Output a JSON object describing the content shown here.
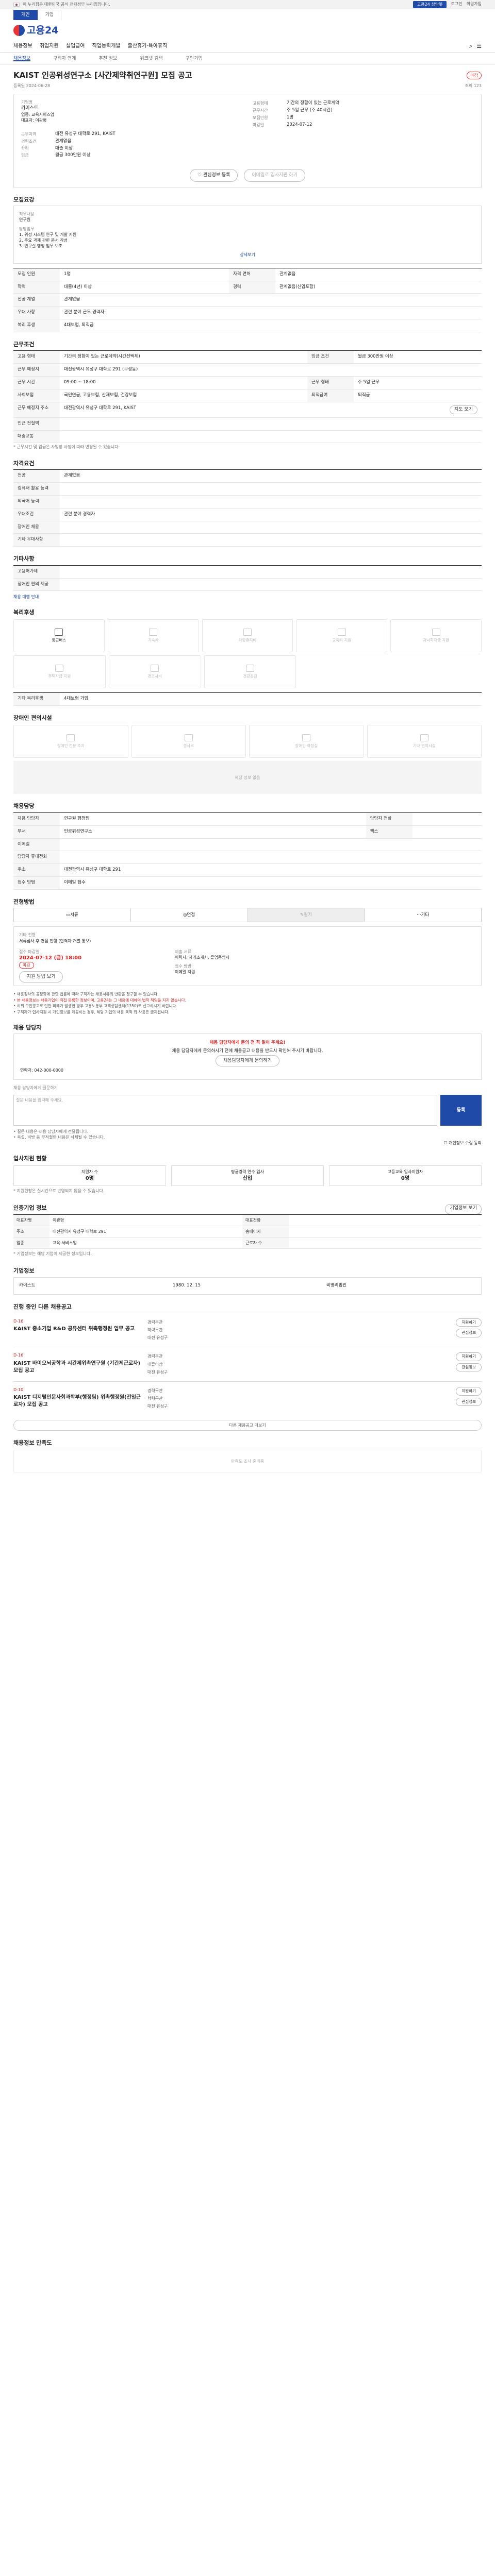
{
  "govbar": {
    "text": "이 누리집은 대한민국 공식 전자정부 누리집입니다.",
    "chat": "고용24 상담봇",
    "links": [
      "로그인",
      "회원가입"
    ]
  },
  "site_tabs": [
    "개인",
    "기업"
  ],
  "logo": "고용24",
  "nav": [
    "채용정보",
    "취업지원",
    "실업급여",
    "직업능력개발",
    "출산휴가·육아휴직"
  ],
  "breadcrumb": [
    "채용정보",
    "구직자 연계",
    "추천 정보",
    "워크넷 검색",
    "구인기업"
  ],
  "job": {
    "title": "KAIST 인공위성연구소 [사간제약취연구원] 모집 공고",
    "badge": "마감",
    "posted": "등록일 2024-06-28",
    "views": "조회 123",
    "company": "카이스트",
    "company_label": "기업명",
    "company_detail": [
      "업종: 교육서비스업",
      "대표자: 이광형"
    ],
    "left_kv": [
      [
        "근무지역",
        "대전 유성구 대학로 291, KAIST"
      ],
      [
        "경력조건",
        "관계없음"
      ],
      [
        "학력",
        "대졸 이상"
      ],
      [
        "임금",
        "월급 300만원 이상"
      ]
    ],
    "right_kv": [
      [
        "고용형태",
        "기간의 정함이 있는 근로계약"
      ],
      [
        "근무시간",
        "주 5일 근무 (주 40시간)"
      ],
      [
        "모집인원",
        "1명"
      ],
      [
        "마감일",
        "2024-07-12"
      ]
    ],
    "btn_save": "관심정보 등록",
    "btn_apply": "이메일로 입사지원 하기"
  },
  "recruit": {
    "title": "모집요강",
    "job_name_label": "직무내용",
    "job_name": "연구원",
    "duties_label": "담당업무",
    "duties": [
      "1. 위성 시스템 연구 및 개발 지원",
      "2. 주요 과제 관련 문서 작성",
      "3. 연구실 행정 업무 보조"
    ],
    "toggle": "상세보기",
    "rows": [
      [
        "모집 인원",
        "1명",
        "자격 면허",
        "관계없음"
      ],
      [
        "학력",
        "대졸(4년) 이상",
        "경력",
        "관계없음(신입포함)"
      ],
      [
        "전공 계열",
        "관계없음",
        "",
        ""
      ],
      [
        "우대 사항",
        "관련 분야 근무 경력자",
        "",
        ""
      ],
      [
        "복리 후생",
        "4대보험, 퇴직금",
        "",
        ""
      ]
    ]
  },
  "work": {
    "title": "근무조건",
    "rows": [
      [
        "고용 형태",
        "기간의 정함이 있는 근로계약(시간선택제)",
        "임금 조건",
        "월급 300만원 이상"
      ],
      [
        "근무 예정지",
        "대전광역시 유성구 대학로 291 (구성동)",
        "",
        ""
      ],
      [
        "근무 시간",
        "09:00 ~ 18:00",
        "근무 형태",
        "주 5일 근무"
      ],
      [
        "사회보험",
        "국민연금, 고용보험, 산재보험, 건강보험",
        "퇴직급여",
        "퇴직금"
      ],
      [
        "근무 예정지 주소",
        "대전광역시 유성구 대학로 291, KAIST",
        "",
        ""
      ],
      [
        "인근 전철역",
        "",
        "",
        ""
      ],
      [
        "대중교통",
        "",
        "",
        ""
      ]
    ],
    "map_btn": "지도 보기",
    "note": "* 근무시간 및 임금은 사업장 사정에 따라 변경될 수 있습니다."
  },
  "qual": {
    "title": "자격요건",
    "rows": [
      [
        "전공",
        "관계없음"
      ],
      [
        "컴퓨터 활용 능력",
        ""
      ],
      [
        "외국어 능력",
        ""
      ],
      [
        "우대조건",
        "관련 분야 경력자"
      ],
      [
        "장애인 채용",
        ""
      ],
      [
        "기타 우대사항",
        ""
      ]
    ]
  },
  "etc": {
    "title": "기타사항",
    "rows": [
      [
        "고용허가제",
        ""
      ],
      [
        "장애인 편의 제공",
        ""
      ]
    ],
    "link": "채용 대행 안내"
  },
  "welfare": {
    "title": "복리후생",
    "items": [
      "통근버스",
      "기숙사",
      "차량유지비",
      "교육비 지원",
      "자녀학자금 지원",
      "주택자금 지원",
      "경조사비",
      "건강검진"
    ],
    "other_label": "기타 복리후생",
    "other": "4대보험 가입"
  },
  "disability": {
    "title": "장애인 편의시설",
    "items": [
      "장애인 전용 주차",
      "경사로",
      "장애인 화장실",
      "기타 편의시설"
    ],
    "empty": "해당 정보 없음"
  },
  "contact": {
    "title": "채용담당",
    "rows": [
      [
        "채용 담당자",
        "연구원 행정팀",
        "담당자 전화",
        ""
      ],
      [
        "부서",
        "인공위성연구소",
        "팩스",
        ""
      ],
      [
        "이메일",
        "",
        "",
        ""
      ],
      [
        "담당자 휴대전화",
        "",
        "",
        ""
      ],
      [
        "주소",
        "대전광역시 유성구 대학로 291",
        "",
        ""
      ],
      [
        "접수 방법",
        "이메일 접수",
        "",
        ""
      ]
    ]
  },
  "apply": {
    "title": "전형방법",
    "steps": [
      "서류",
      "면접",
      "필기",
      "기타"
    ],
    "active": 2,
    "method_label": "기타 전형",
    "method": "서류심사 후 면접 진행 (합격자 개별 통보)",
    "deadline_label": "접수 마감일",
    "deadline": "2024-07-12 (금) 18:00",
    "badge": "마감",
    "docs_label": "제출 서류",
    "docs": "이력서, 자기소개서, 졸업증명서",
    "apply_label": "접수 방법",
    "apply_way": "이메일 지원",
    "method_btn": "지원 방법 보기"
  },
  "legal": [
    "• 채용절차의 공정화에 관한 법률에 따라 구직자는 채용서류의 반환을 청구할 수 있습니다.",
    "• 본 채용정보는 채용기업이 직접 등록한 정보이며, 고용24는 그 내용에 대하여 법적 책임을 지지 않습니다.",
    "• 허위 구인광고로 인한 피해가 발생한 경우 고용노동부 고객상담센터(1350)로 신고하시기 바랍니다.",
    "• 구직자가 입사지원 시 개인정보를 제공하는 경우, 해당 기업의 채용 목적 외 사용은 금지됩니다."
  ],
  "warn": {
    "title": "채용 담당자",
    "head": "채용 담당자에게 문의 전 꼭 읽어 주세요!",
    "body": "채용 담당자에게 문의하시기 전에 채용공고 내용을 반드시 확인해 주시기 바랍니다.",
    "btn": "채용담당자에게 문의하기",
    "contact_line": "연락처: 042-000-0000",
    "qa_label": "채용 담당자에게 질문하기",
    "qa_placeholder": "질문 내용을 입력해 주세요.",
    "qa_submit": "등록",
    "notes": [
      "• 질문 내용은 채용 담당자에게 전달됩니다.",
      "• 욕설, 비방 등 부적절한 내용은 삭제될 수 있습니다."
    ],
    "privacy": "개인정보 수집 동의"
  },
  "stats": {
    "title": "입사지원 현황",
    "items": [
      [
        "지원자 수",
        "0명"
      ],
      [
        "평균경력 연수 입사",
        "신입"
      ],
      [
        "고등교육 입사지원자",
        "0명"
      ]
    ],
    "note": "* 지원현황은 실시간으로 반영되지 않을 수 있습니다."
  },
  "company_info": {
    "title": "인증기업 정보",
    "btn": "기업정보 보기",
    "rows": [
      [
        "대표자명",
        "이광형",
        "대표전화",
        ""
      ],
      [
        "주소",
        "대전광역시 유성구 대학로 291",
        "홈페이지",
        ""
      ],
      [
        "업종",
        "교육 서비스업",
        "근로자 수",
        ""
      ]
    ],
    "note": "* 기업정보는 해당 기업이 제공한 정보입니다."
  },
  "company_profile": {
    "title": "기업정보",
    "name": "카이스트",
    "founded": "1980. 12. 15",
    "type": "비영리법인"
  },
  "other_jobs": {
    "title": "진행 중인 다른 채용공고",
    "cards": [
      {
        "dl": "D-16",
        "title": "KAIST 중소기업 R&D 공유센터 위촉행정원 업무 공고",
        "meta": [
          "경력무관",
          "학력무관",
          "대전 유성구"
        ],
        "btns": [
          "지원하기",
          "관심정보"
        ]
      },
      {
        "dl": "D-16",
        "title": "KAIST 바이오뇌공학과 시간제위촉연구원 (기간제근로자) 모집 공고",
        "meta": [
          "경력무관",
          "대졸이상",
          "대전 유성구"
        ],
        "btns": [
          "지원하기",
          "관심정보"
        ]
      },
      {
        "dl": "D-10",
        "title": "KAIST 디지털인문사회과학부(행정팀) 위촉행정원(전일근로자) 모집 공고",
        "meta": [
          "경력무관",
          "학력무관",
          "대전 유성구"
        ],
        "btns": [
          "지원하기",
          "관심정보"
        ]
      }
    ],
    "more": "다른 채용공고 더보기"
  },
  "feedback": {
    "title": "채용정보 만족도",
    "empty": "만족도 조사 준비중"
  }
}
